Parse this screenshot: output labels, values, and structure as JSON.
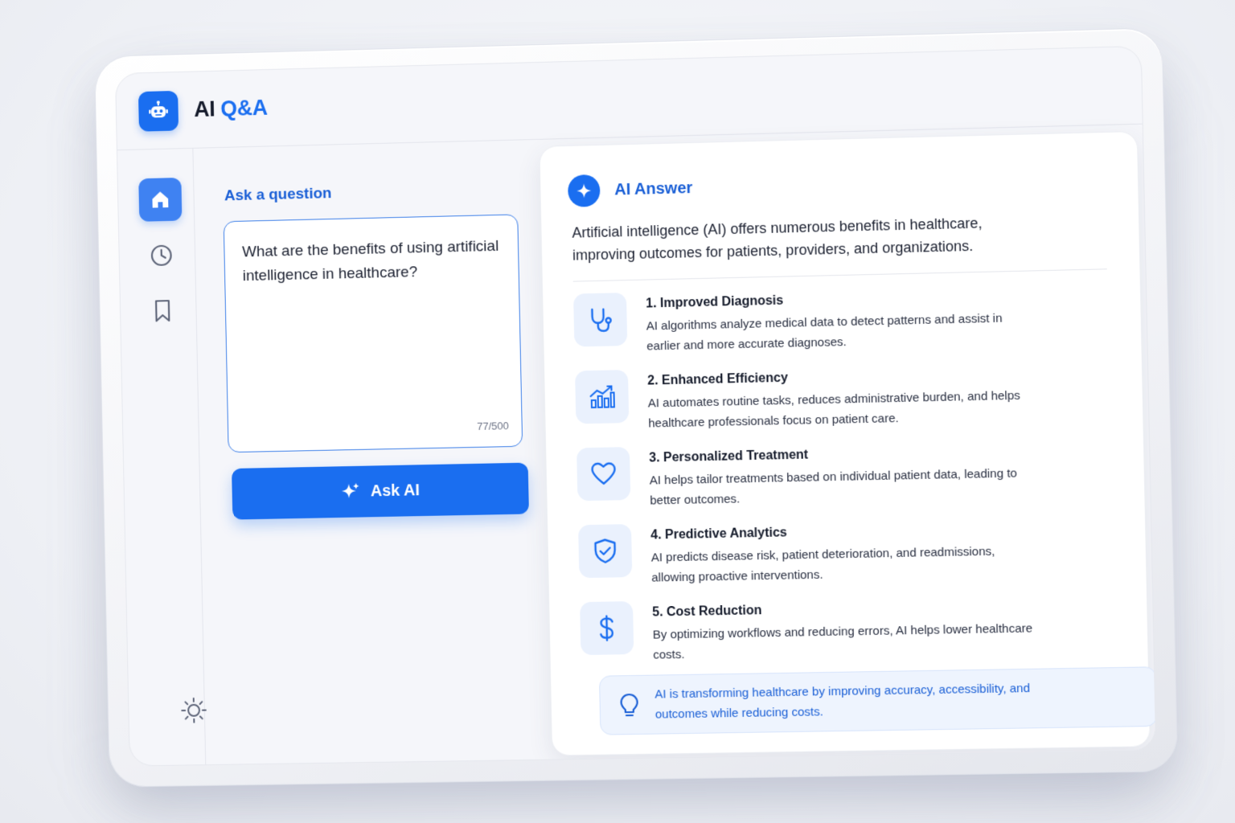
{
  "app": {
    "title_main": "AI",
    "title_accent": "Q&A",
    "logo_icon": "robot-icon"
  },
  "sidebar": {
    "items": [
      {
        "name": "home",
        "icon": "home-icon",
        "active": true
      },
      {
        "name": "history",
        "icon": "clock-icon",
        "active": false
      },
      {
        "name": "saved",
        "icon": "bookmark-icon",
        "active": false
      }
    ],
    "settings_icon": "sun-icon"
  },
  "question": {
    "label": "Ask a question",
    "value": "What are the benefits of using artificial intelligence in healthcare?",
    "char_count": "77/500",
    "ask_button_label": "Ask AI"
  },
  "answer": {
    "title": "AI Answer",
    "intro": "Artificial intelligence (AI) offers numerous benefits in healthcare, improving outcomes for patients, providers, and organizations.",
    "items": [
      {
        "title": "1. Improved Diagnosis",
        "desc": "AI algorithms analyze medical data to detect patterns and assist in earlier and more accurate diagnoses.",
        "icon": "stethoscope-icon"
      },
      {
        "title": "2. Enhanced Efficiency",
        "desc": "AI automates routine tasks, reduces administrative burden, and helps healthcare professionals focus on patient care.",
        "icon": "chart-growth-icon"
      },
      {
        "title": "3. Personalized Treatment",
        "desc": "AI helps tailor treatments based on individual patient data, leading to better outcomes.",
        "icon": "heart-icon"
      },
      {
        "title": "4. Predictive Analytics",
        "desc": "AI predicts disease risk, patient deterioration, and readmissions, allowing proactive interventions.",
        "icon": "shield-check-icon"
      },
      {
        "title": "5. Cost Reduction",
        "desc": "By optimizing workflows and reducing errors, AI helps lower healthcare costs.",
        "icon": "dollar-icon"
      }
    ],
    "tip": "AI is transforming healthcare by improving accuracy, accessibility, and outcomes while reducing costs.",
    "tip_icon": "lightbulb-icon"
  },
  "colors": {
    "accent": "#1a6ef0",
    "accent_text": "#1a5fd6",
    "icon_tile": "#eaf1fd"
  }
}
